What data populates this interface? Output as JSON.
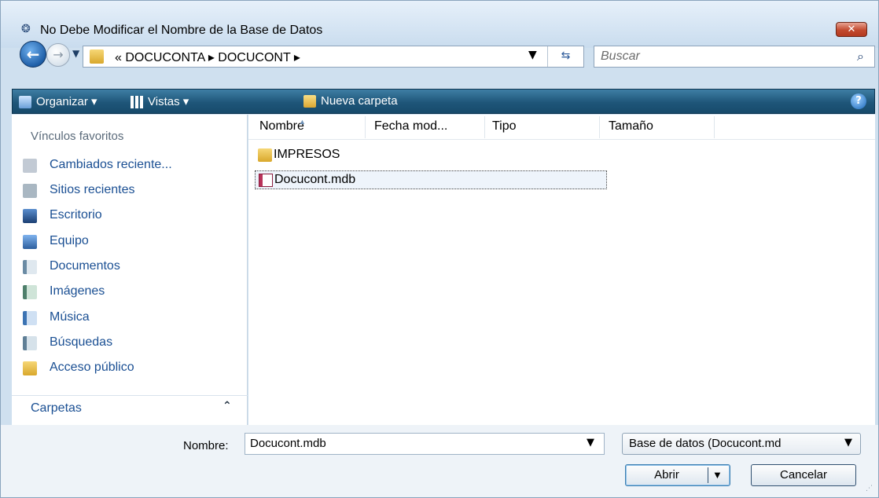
{
  "window": {
    "title": "No Debe Modificar el Nombre de la Base de Datos",
    "close_label": "✕"
  },
  "address": {
    "path": "« DOCUCONTA ▸ DOCUCONT ▸",
    "search_placeholder": "Buscar"
  },
  "toolbar": {
    "organize_label": "Organizar ▾",
    "views_label": "Vistas ▾",
    "new_folder_label": "Nueva carpeta",
    "help_label": "?"
  },
  "sidebar": {
    "header": "Vínculos favoritos",
    "items": [
      {
        "label": "Cambiados reciente...",
        "icon": "recent-changes-icon",
        "color": "#8a96a6"
      },
      {
        "label": "Sitios recientes",
        "icon": "recent-sites-icon",
        "color": "#7d8f9c"
      },
      {
        "label": "Escritorio",
        "icon": "desktop-icon",
        "color": "#2f5d94"
      },
      {
        "label": "Equipo",
        "icon": "computer-icon",
        "color": "#3b6aa8"
      },
      {
        "label": "Documentos",
        "icon": "documents-icon",
        "color": "#6a8ba4"
      },
      {
        "label": "Imágenes",
        "icon": "pictures-icon",
        "color": "#4e7f6b"
      },
      {
        "label": "Música",
        "icon": "music-icon",
        "color": "#3b73b3"
      },
      {
        "label": "Búsquedas",
        "icon": "searches-icon",
        "color": "#5f7f96"
      },
      {
        "label": "Acceso público",
        "icon": "public-folder-icon",
        "color": "#d9a82c"
      }
    ],
    "folders_label": "Carpetas"
  },
  "filelist": {
    "columns": [
      "Nombre",
      "Fecha mod...",
      "Tipo",
      "Tamaño"
    ],
    "rows": [
      {
        "name": "IMPRESOS",
        "icon": "folder-icon"
      },
      {
        "name": "Docucont.mdb",
        "icon": "access-db-icon",
        "selected": true
      }
    ]
  },
  "footer": {
    "name_label": "Nombre:",
    "name_value": "Docucont.mdb",
    "file_type": "Base de datos (Docucont.md",
    "open_label": "Abrir",
    "cancel_label": "Cancelar"
  }
}
